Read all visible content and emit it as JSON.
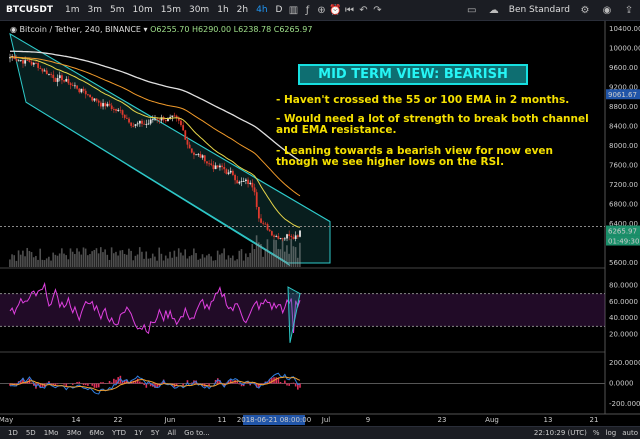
{
  "toolbar": {
    "symbol": "BTCUSDT",
    "timeframes": [
      "1m",
      "3m",
      "5m",
      "10m",
      "15m",
      "30m",
      "1h",
      "2h",
      "4h",
      "D"
    ],
    "active_timeframe": "4h",
    "user": "Ben Standard"
  },
  "legend": {
    "title": "Bitcoin / Tether, 240, BINANCE",
    "ohlc": "O6255.70 H6290.00 L6238.78 C6265.97"
  },
  "annotation": {
    "headline": "MID TERM VIEW: BEARISH",
    "note1": "- Haven't crossed the 55 or 100 EMA in 2 months.",
    "note2": "- Would need a lot of strength to break both channel and EMA resistance.",
    "note3": "- Leaning towards a bearish view for now even though we see higher lows on the RSI."
  },
  "price_axis": {
    "ticks": [
      "10400.00",
      "10000.00",
      "9600.00",
      "9200.00",
      "8800.00",
      "8400.00",
      "8000.00",
      "7600.00",
      "7200.00",
      "6800.00",
      "6400.00",
      "6000.00",
      "5600.00"
    ],
    "tick_values": [
      10400,
      10000,
      9600,
      9200,
      8800,
      8400,
      8000,
      7600,
      7200,
      6800,
      6400,
      6000,
      5600
    ],
    "marker_high": "9061.67",
    "marker_last": "6265.97",
    "marker_timer": "01:49:30"
  },
  "rsi_axis": {
    "ticks": [
      "80.0000",
      "60.0000",
      "40.0000",
      "20.0000"
    ],
    "tick_values": [
      80,
      60,
      40,
      20
    ]
  },
  "macd_axis": {
    "ticks": [
      "200.0000",
      "0.0000",
      "-200.0000"
    ],
    "tick_values": [
      200,
      0,
      -200
    ]
  },
  "x_axis": {
    "labels": [
      "May",
      "14",
      "22",
      "Jun",
      "11",
      "Jul",
      "9",
      "23",
      "Aug",
      "13",
      "21"
    ],
    "cursor_label": "2018-06-21 08:00:00"
  },
  "bottom_bar": {
    "ranges": [
      "1D",
      "5D",
      "1Mo",
      "3Mo",
      "6Mo",
      "YTD",
      "1Y",
      "5Y",
      "All",
      "Go to..."
    ],
    "clock": "22:10:29 (UTC)",
    "pct": "%",
    "log": "log",
    "auto": "auto"
  },
  "colors": {
    "candle_up": "#e6e6e6",
    "candle_down": "#e03a2e",
    "ema_fast": "#e7d64a",
    "ema_mid": "#f09a2a",
    "ema_slow": "#e0e0e0",
    "channel": "#2ec8c8",
    "rsi": "#e040e0",
    "macd": "#2f7fe0",
    "signal": "#f0a030",
    "hist": "#e0305a",
    "note": "#f5e000"
  }
}
